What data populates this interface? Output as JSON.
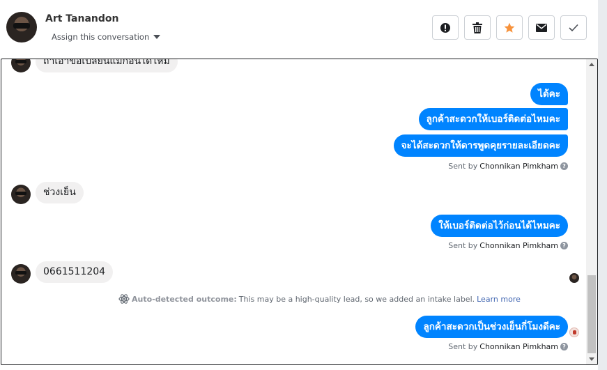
{
  "header": {
    "name": "Art Tanandon",
    "assign_label": "Assign this conversation"
  },
  "actions": [
    {
      "name": "mark-spam-button",
      "icon": "exclamation-icon"
    },
    {
      "name": "delete-button",
      "icon": "trash-icon"
    },
    {
      "name": "star-button",
      "icon": "star-icon",
      "color": "#f7923b"
    },
    {
      "name": "mark-unread-button",
      "icon": "envelope-icon"
    },
    {
      "name": "mark-done-button",
      "icon": "check-icon"
    }
  ],
  "messages": {
    "in_1": "ถ้าเอาข้อเปลี่ยนแม่ก่อนได้ไหม",
    "out_1a": "ได้คะ",
    "out_1b": "ลูกค้าสะดวกให้เบอร์ติดต่อไหมคะ",
    "out_1c": "จะได้สะดวกให้ดารพูดคุยรายละเอียดคะ",
    "in_2": "ช่วงเย็น",
    "out_2": "ให้เบอร์ติดต่อไว้ก่อนได้ไหมคะ",
    "in_3": "0661511204",
    "out_3": "ลูกค้าสะดวกเป็นช่วงเย็นกี่โมงดีคะ"
  },
  "sent_by": {
    "prefix": "Sent by",
    "agent": "Chonnikan Pimkham",
    "help": "?"
  },
  "outcome": {
    "label": "Auto-detected outcome:",
    "text": "This may be a high-quality lead, so we added an intake label.",
    "link": "Learn more"
  },
  "colors": {
    "outgoing_bubble": "#0084ff",
    "incoming_bubble": "#f1f0f0",
    "star": "#f7923b",
    "link": "#4267b2"
  }
}
